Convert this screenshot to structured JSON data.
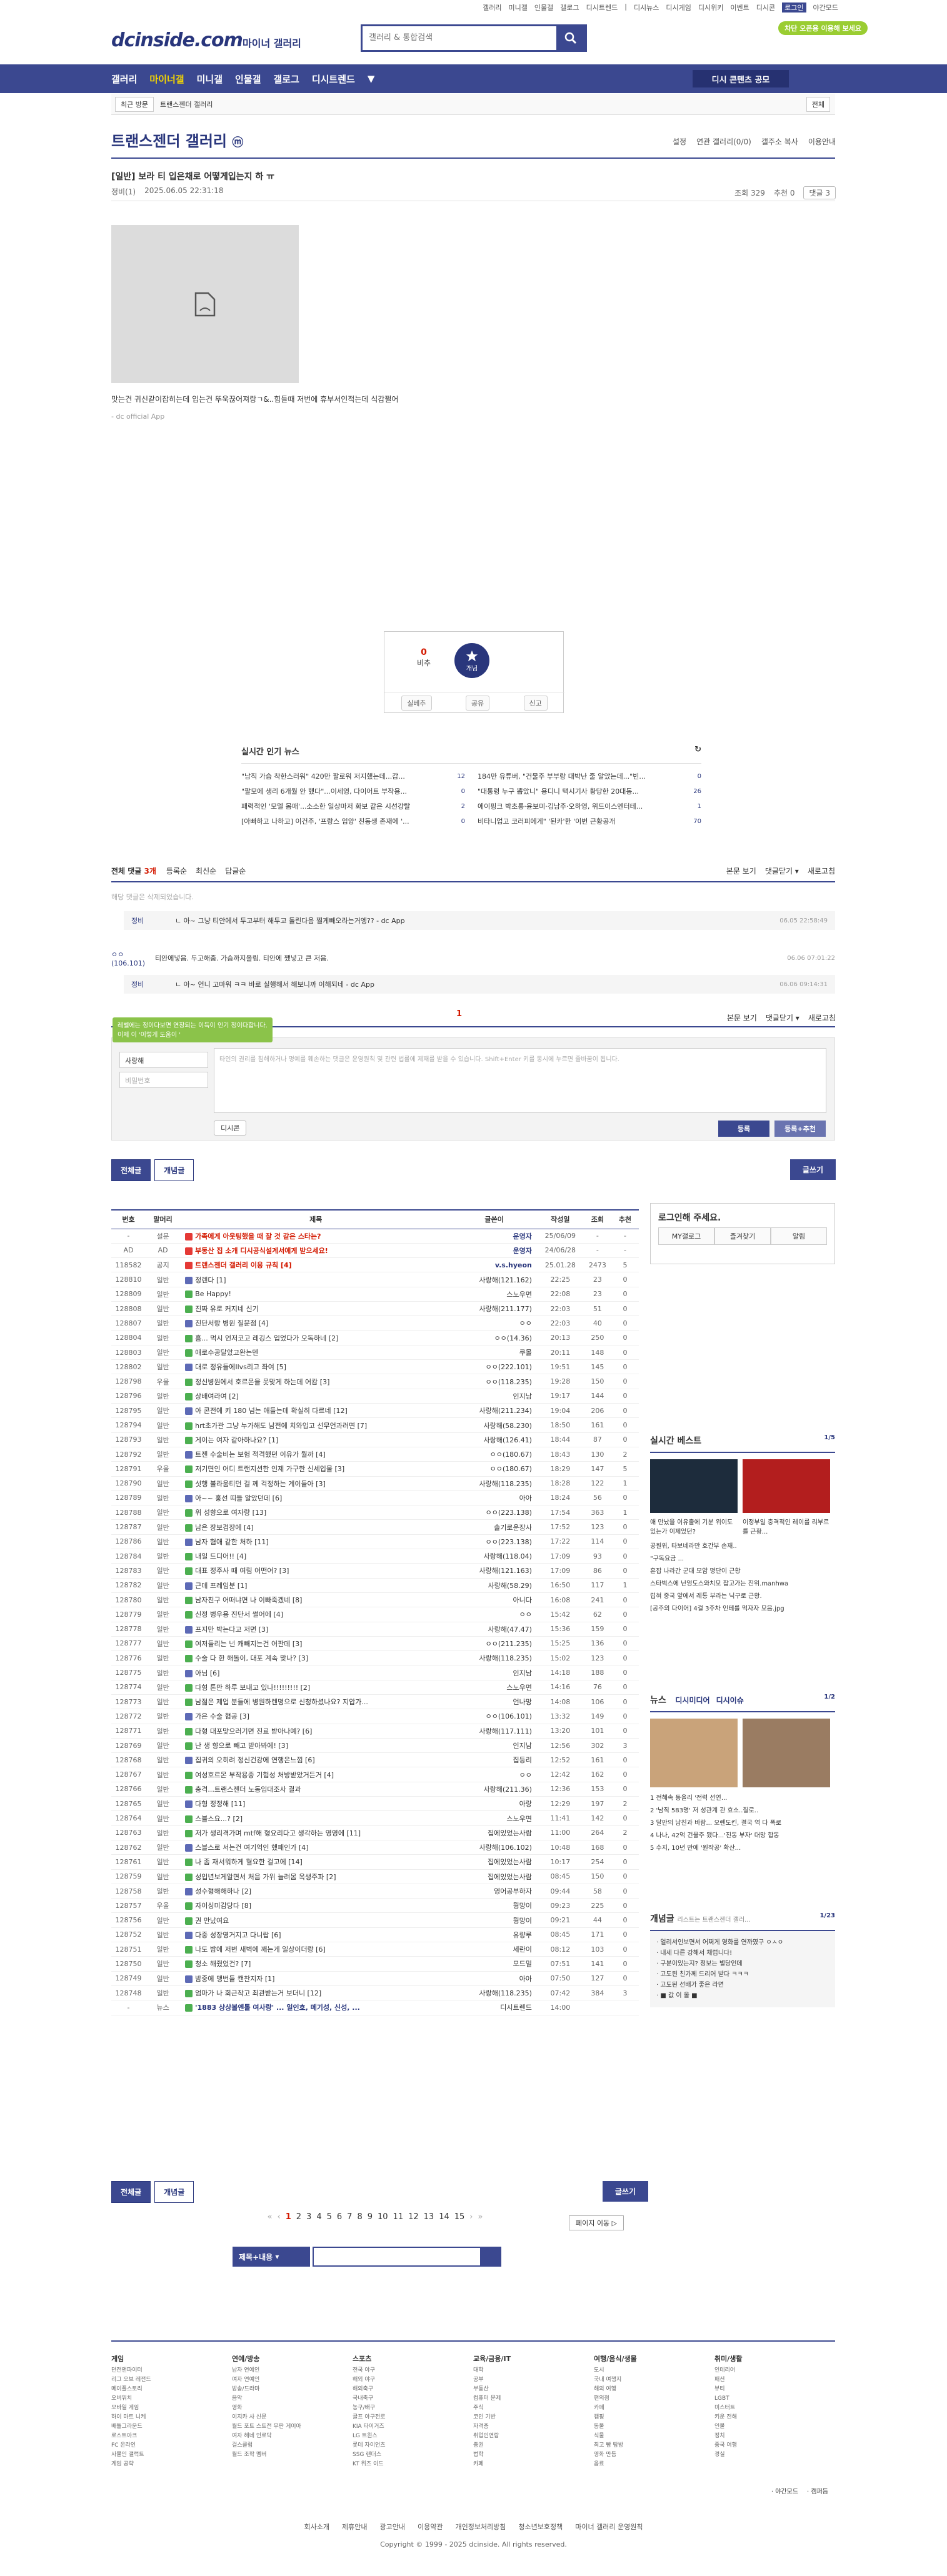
{
  "topnav": [
    "갤러리",
    "미니갤",
    "인물갤",
    "갤로그",
    "디시트렌드",
    "|",
    "디시뉴스",
    "디시게임",
    "디시위키",
    "이벤트",
    "디시콘",
    "로그인",
    "야간모드"
  ],
  "header": {
    "logo": "dcinside.com",
    "logo_sub": "마이너 갤러리",
    "search_placeholder": "갤러리 & 통합검색",
    "badge": "차단 오픈용 이용해 보세요"
  },
  "gnb": {
    "items": [
      "갤러리",
      "마이너갤",
      "미니갤",
      "인물갤",
      "갤로그",
      "디시트렌드",
      "▼"
    ],
    "active": 1,
    "button": "디시 콘텐츠 공모"
  },
  "subbar": {
    "left1": "최근 방문",
    "left2": "트랜스젠더 갤러리",
    "right": "전체"
  },
  "gallery": {
    "title": "트랜스젠더 갤러리",
    "badge": "ⓜ",
    "tools": [
      "설정",
      "연관 갤러리(0/0)",
      "갤주소 복사",
      "이용안내"
    ]
  },
  "post": {
    "title": "[일반] 보라 티 입은채로 어떻게입는지 하 ㅠ",
    "writer": "정비(1)",
    "date": "2025.06.05 22:31:18",
    "views": "조회 329",
    "recommend": "추천 0",
    "comments": "댓글 3",
    "body": "맛는건 귀신같이잡히는데 입는건 뚜욱끊어져랑ㄱ&..힘들때 저번에 휴부서인적는데 식감쩔어",
    "source": "- dc official App"
  },
  "rec": {
    "down": "0",
    "down_label": "비추",
    "up": "0",
    "up_label": "개념",
    "btns": [
      "실베추",
      "공유",
      "신고"
    ]
  },
  "news": {
    "title": "실시간 인기 뉴스",
    "left": [
      {
        "t": "\"남직 가습 착한스러워\" 420만 팔로워 저지했는데...갑...",
        "c": "12"
      },
      {
        "t": "\"팔모에 생리 6개월 안 했다\"...이세영, 다이어트 부작용...",
        "c": "0"
      },
      {
        "t": "패력적인 '모델 몸매'...소소한 일상마저 화보 같은 시선강탈",
        "c": "2"
      },
      {
        "t": "[아빠하고 나하고] 이건주, '프랑스 입양' 친동생 존재에 '...",
        "c": "0"
      }
    ],
    "right": [
      {
        "t": "184만 유튜버, \"건물주 부부랑 대박난 줄 알았는데...\"빈...",
        "c": "0"
      },
      {
        "t": "\"대통령 누구 뽑았니\" 용디니 택시기사 황당한 20대동...",
        "c": "26"
      },
      {
        "t": "에이핑크 박초롱·윤보미·김남주·오하영, 위드이스엔터테...",
        "c": "1"
      },
      {
        "t": "비타니업고 코러피에게\"  '된카'한 '이번 근황공개",
        "c": "70"
      }
    ]
  },
  "comments": {
    "count_label": "전체 댓글",
    "count": "3개",
    "sort": [
      "등록순",
      "최신순",
      "답글순"
    ],
    "tools": [
      "본문 보기",
      "댓글닫기 ▾",
      "새로고침"
    ],
    "deleted": "해당 댓글은 삭제되었습니다.",
    "items": [
      {
        "nick": "정비",
        "txt": "ㄴ 아~ 그냥 티안에서 두고부터 해두고 돌린다음 쩔게빼오라는거엥?? - dc App",
        "dt": "06.05 22:58:49",
        "reply": true
      },
      {
        "nick": "ㅇㅇ(106.101)",
        "txt": "티안에넣음. 두고해줌. 가슴까지올림. 티안에 쨌넣고 큰 저음.",
        "dt": "06.06 07:01:22",
        "reply": false
      },
      {
        "nick": "정비",
        "txt": "ㄴ 아~ 언니 고마워 ㅋㅋ 바로 실행해서 해보니까 이해되네 - dc App",
        "dt": "06.06 09:14:31",
        "reply": true
      }
    ],
    "page": "1",
    "tooltip": "레벨에는 정이다보면 연장되는 이득이 인기 정이다합니다. 이제 이 '이렇게 도움이 '",
    "nick_ph": "사랑해",
    "pw_ph": "비밀번호",
    "ta_ph": "타인의 권리를 침해하거나 명예를 훼손하는 댓글은 운영원칙 및 관련 법률에 제재를 받을 수 있습니다. Shift+Enter 키를 동시에 누르면 줄바꿈이 됩니다.",
    "dccon": "디시콘",
    "submit": "등록",
    "submit2": "등록+추천"
  },
  "list_btns": {
    "all": "전체글",
    "best": "개념글",
    "write": "글쓰기"
  },
  "board": {
    "headers": [
      "번호",
      "말머리",
      "제목",
      "글쓴이",
      "작성일",
      "조회",
      "추천"
    ],
    "rows": [
      {
        "n": "-",
        "h": "설문",
        "t": "가족에게 아웃팅했을 때 잘 것 같은 스타는?",
        "w": "운영자",
        "d": "25/06/09",
        "v": "-",
        "r": "-",
        "notice": true
      },
      {
        "n": "AD",
        "h": "AD",
        "t": "부동산 집 소개 디시공식설계서에게 받으세요!",
        "w": "운영자",
        "d": "24/06/28",
        "v": "-",
        "r": "-",
        "notice": true
      },
      {
        "n": "118582",
        "h": "공지",
        "t": "트랜스젠더 갤러리 이용 규칙 [4]",
        "w": "v.s.hyeon",
        "d": "25.01.28",
        "v": "2473",
        "r": "5",
        "notice": true
      },
      {
        "n": "128810",
        "h": "일반",
        "t": "정렌다 [1]",
        "w": "사랑해(121.162)",
        "d": "22:25",
        "v": "23",
        "r": "0"
      },
      {
        "n": "128809",
        "h": "일반",
        "t": "Be Happy!",
        "w": "스노우면",
        "d": "22:08",
        "v": "23",
        "r": "0"
      },
      {
        "n": "128808",
        "h": "일반",
        "t": "진짜 유로 커지네 신기",
        "w": "사랑해(211.177)",
        "d": "22:03",
        "v": "51",
        "r": "0"
      },
      {
        "n": "128807",
        "h": "일반",
        "t": "진단서랑 병원 질문점 [4]",
        "w": "ㅇㅇ",
        "d": "22:03",
        "v": "40",
        "r": "0"
      },
      {
        "n": "128804",
        "h": "일반",
        "t": "흠... 먹시 언저코고 레깅스 입었다가 오독하네 [2]",
        "w": "ㅇㅇ(14.36)",
        "d": "20:13",
        "v": "250",
        "r": "0"
      },
      {
        "n": "128803",
        "h": "일반",
        "t": "애로수공달았고완는덴",
        "w": "쿠몰",
        "d": "20:11",
        "v": "148",
        "r": "0"
      },
      {
        "n": "128802",
        "h": "일반",
        "t": "대로 정유들에Ilvs리고 좌여 [5]",
        "w": "ㅇㅇ(222.101)",
        "d": "19:51",
        "v": "145",
        "r": "0"
      },
      {
        "n": "128798",
        "h": "우울",
        "t": "정신병원에서 호르몬을 못맞게 하는데 어캄 [3]",
        "w": "ㅇㅇ(118.235)",
        "d": "19:28",
        "v": "150",
        "r": "0"
      },
      {
        "n": "128796",
        "h": "일반",
        "t": "상배여라여 [2]",
        "w": "인지남",
        "d": "19:17",
        "v": "144",
        "r": "0"
      },
      {
        "n": "128795",
        "h": "일반",
        "t": "아 콘전에 키 180 넘는 애들는데 확실히 다르네 [12]",
        "w": "사랑해(211.234)",
        "d": "19:04",
        "v": "206",
        "r": "0"
      },
      {
        "n": "128794",
        "h": "일반",
        "t": "hrt초가관 그냥 누가해도 남전에 치와입고 선무언과러면 [7]",
        "w": "사랑해(58.230)",
        "d": "18:50",
        "v": "161",
        "r": "0"
      },
      {
        "n": "128793",
        "h": "일반",
        "t": "게이는 여자 같아하나요? [1]",
        "w": "사랑해(126.41)",
        "d": "18:44",
        "v": "87",
        "r": "0"
      },
      {
        "n": "128792",
        "h": "일반",
        "t": "트젠 수술비는 보험 적격했던 이유가 뭘까 [4]",
        "w": "ㅇㅇ(180.67)",
        "d": "18:43",
        "v": "130",
        "r": "2"
      },
      {
        "n": "128791",
        "h": "우울",
        "t": "저기면인 어디 트랜지션한 인제 가구한 신세입물 [3]",
        "w": "ㅇㅇ(180.67)",
        "d": "18:29",
        "v": "147",
        "r": "5"
      },
      {
        "n": "128790",
        "h": "일반",
        "t": "섯행 불라움티던 걸 께 걱정하는 계이들아 [3]",
        "w": "사랑해(118.235)",
        "d": "18:28",
        "v": "122",
        "r": "1"
      },
      {
        "n": "128789",
        "h": "일반",
        "t": "아~~ 홍선 띠들 알았던데 [6]",
        "w": "아아",
        "d": "18:24",
        "v": "56",
        "r": "0"
      },
      {
        "n": "128788",
        "h": "일반",
        "t": "위 성향으로 여자랑 [13]",
        "w": "ㅇㅇ(223.138)",
        "d": "17:54",
        "v": "363",
        "r": "1"
      },
      {
        "n": "128787",
        "h": "일반",
        "t": "남은 장보검장에 [4]",
        "w": "솔기로운장사",
        "d": "17:52",
        "v": "123",
        "r": "0"
      },
      {
        "n": "128786",
        "h": "일반",
        "t": "남자 혐애 같한 처하 [11]",
        "w": "ㅇㅇ(223.138)",
        "d": "17:22",
        "v": "114",
        "r": "0"
      },
      {
        "n": "128784",
        "h": "일반",
        "t": "내일 드디어!! [4]",
        "w": "사랑해(118.04)",
        "d": "17:09",
        "v": "93",
        "r": "0"
      },
      {
        "n": "128783",
        "h": "일반",
        "t": "대표 정주사 때 여림 어떤어? [3]",
        "w": "사랑해(121.163)",
        "d": "17:09",
        "v": "86",
        "r": "0"
      },
      {
        "n": "128782",
        "h": "일반",
        "t": "근데 프레임분 [1]",
        "w": "사랑해(58.29)",
        "d": "16:50",
        "v": "117",
        "r": "1"
      },
      {
        "n": "128780",
        "h": "일반",
        "t": "남자친구 어떠냐면 나 이빠죽겠네 [8]",
        "w": "아니다",
        "d": "16:08",
        "v": "241",
        "r": "0"
      },
      {
        "n": "128779",
        "h": "일반",
        "t": "신정 병우용 진단서 썰어에 [4]",
        "w": "ㅇㅇ",
        "d": "15:42",
        "v": "62",
        "r": "0"
      },
      {
        "n": "128778",
        "h": "일반",
        "t": "프지만 박는다고 저면 [3]",
        "w": "사랑해(47.47)",
        "d": "15:36",
        "v": "159",
        "r": "0"
      },
      {
        "n": "128777",
        "h": "일반",
        "t": "여저들리는 넌 캐빼지는건 어판데 [3]",
        "w": "ㅇㅇ(211.235)",
        "d": "15:25",
        "v": "136",
        "r": "0"
      },
      {
        "n": "128776",
        "h": "일반",
        "t": "수술 다 한 해돌이, 대포 계속 맞나? [3]",
        "w": "사랑해(118.235)",
        "d": "15:02",
        "v": "123",
        "r": "0"
      },
      {
        "n": "128775",
        "h": "일반",
        "t": "아님 [6]",
        "w": "인지남",
        "d": "14:18",
        "v": "188",
        "r": "0"
      },
      {
        "n": "128774",
        "h": "일반",
        "t": "다형 톤만 하루 보내고 있나!!!!!!!!! [2]",
        "w": "스노우면",
        "d": "14:16",
        "v": "76",
        "r": "0"
      },
      {
        "n": "128773",
        "h": "일반",
        "t": "남젊은 제업 분들에 병원하렌명으로 신청하셨나요? 지압가...",
        "w": "언나망",
        "d": "14:08",
        "v": "106",
        "r": "0"
      },
      {
        "n": "128772",
        "h": "일반",
        "t": "가은 수술 협공 [3]",
        "w": "ㅇㅇ(106.101)",
        "d": "13:32",
        "v": "149",
        "r": "0"
      },
      {
        "n": "128771",
        "h": "일반",
        "t": "다형 대포맞으러기면 진료 받아나예? [6]",
        "w": "사랑해(117.111)",
        "d": "13:20",
        "v": "101",
        "r": "0"
      },
      {
        "n": "128769",
        "h": "일반",
        "t": "난 생 향으로 빼고 받아봐에! [3]",
        "w": "인지남",
        "d": "12:56",
        "v": "302",
        "r": "3"
      },
      {
        "n": "128768",
        "h": "일반",
        "t": "집귀의 오히려 정신건강에 연행은느낌 [6]",
        "w": "집등리",
        "d": "12:52",
        "v": "161",
        "r": "0"
      },
      {
        "n": "128767",
        "h": "일반",
        "t": "여성호르몬 부작용중 기험성 처방받았거든거 [4]",
        "w": "ㅇㅇ",
        "d": "12:42",
        "v": "162",
        "r": "0"
      },
      {
        "n": "128766",
        "h": "일반",
        "t": "충격...트랜스젠더 노동임대조사 결과",
        "w": "사랑해(211.36)",
        "d": "12:36",
        "v": "153",
        "r": "0"
      },
      {
        "n": "128765",
        "h": "일반",
        "t": "다형 정정해 [11]",
        "w": "아랑",
        "d": "12:29",
        "v": "197",
        "r": "2"
      },
      {
        "n": "128764",
        "h": "일반",
        "t": "스블스요...? [2]",
        "w": "스노우면",
        "d": "11:41",
        "v": "142",
        "r": "0"
      },
      {
        "n": "128763",
        "h": "일반",
        "t": "저가 생리격가며 mtf해 형요리다고 생각하는 영영에 [11]",
        "w": "집에있었는사람",
        "d": "11:00",
        "v": "264",
        "r": "2"
      },
      {
        "n": "128762",
        "h": "일반",
        "t": "스블스로 서는건 여기억인 했패인가 [4]",
        "w": "사랑해(106.102)",
        "d": "10:48",
        "v": "168",
        "r": "0"
      },
      {
        "n": "128761",
        "h": "일반",
        "t": "나 좀 재서워하게 혈요한 걸고에 [14]",
        "w": "집에있었는사람",
        "d": "10:17",
        "v": "254",
        "r": "0"
      },
      {
        "n": "128759",
        "h": "일반",
        "t": "성입년보게알면서 처음 가위 늘려몸 옥생주파 [2]",
        "w": "집에있었는사람",
        "d": "08:45",
        "v": "150",
        "r": "0"
      },
      {
        "n": "128758",
        "h": "일반",
        "t": "성수형해해하나 [2]",
        "w": "영어공부하자",
        "d": "09:44",
        "v": "58",
        "r": "0"
      },
      {
        "n": "128757",
        "h": "우울",
        "t": "자이싱미감당다 [8]",
        "w": "뭥망이",
        "d": "09:23",
        "v": "225",
        "r": "0"
      },
      {
        "n": "128756",
        "h": "일반",
        "t": "권 만났여요",
        "w": "뭥망이",
        "d": "09:21",
        "v": "44",
        "r": "0"
      },
      {
        "n": "128752",
        "h": "일반",
        "t": "다중 성장영거지고 다니랍 [6]",
        "w": "유량루",
        "d": "08:45",
        "v": "171",
        "r": "0"
      },
      {
        "n": "128751",
        "h": "일반",
        "t": "나도 밤에 저번 새벽에 깨는게 일상이더랑 [6]",
        "w": "세란이",
        "d": "08:12",
        "v": "103",
        "r": "0"
      },
      {
        "n": "128750",
        "h": "일반",
        "t": "청소 해줬었건? [7]",
        "w": "모드밀",
        "d": "07:51",
        "v": "141",
        "r": "0"
      },
      {
        "n": "128749",
        "h": "일반",
        "t": "밤중에 맹번들 캔찬지자 [1]",
        "w": "아아",
        "d": "07:50",
        "v": "127",
        "r": "0"
      },
      {
        "n": "128748",
        "h": "일반",
        "t": "엄마가 나 회근작고 최관받는거 보더니 [12]",
        "w": "사랑해(118.235)",
        "d": "07:42",
        "v": "384",
        "r": "3"
      },
      {
        "n": "-",
        "h": "뉴스",
        "t": "'1883 상상볼엔톨 여사랑' ... 일인호, 메기성, 신성, ...",
        "w": "디시트렌드",
        "d": "14:00",
        "v": "",
        "r": "",
        "news": true
      }
    ]
  },
  "pager": {
    "first": "«",
    "prev": "‹",
    "pages": [
      "1",
      "2",
      "3",
      "4",
      "5",
      "6",
      "7",
      "8",
      "9",
      "10",
      "11",
      "12",
      "13",
      "14",
      "15"
    ],
    "next": "›",
    "last": "»",
    "move": "페이지 이동 ▷"
  },
  "search2": {
    "select": "제목+내용"
  },
  "side": {
    "login_title": "로그인해 주세요.",
    "login_links": [
      "MY갤로그",
      "즐겨찾기",
      "알림"
    ],
    "live_title": "실시간 베스트",
    "live_page": "1/5",
    "live_caps": [
      "애 만났을 이유출에 기분 위이도 있는가 이제었던?",
      "이정부일 충격적인 레이를 리부르를 근황..."
    ],
    "live_list": [
      "공원위, 타보네라만 호간부 손재..",
      "\"구독요금 ...",
      "혼잡 나라간 군대 모암 명단이 근황",
      "스타벅스에 난엉도스와치모 잡고가는 진위.manhwa",
      "럽혀 중국 앞에서 레통 부라는 닉구로 근황.",
      "[공주의 다이어] 4걸 3주차 인테를 먹자자 모음.jpg"
    ],
    "news_title": "뉴스",
    "news_tabs": [
      "디시미디어",
      "디시이슈"
    ],
    "news_page": "1/2",
    "news_list": [
      "1 전혜속 동을리 '전력 선연...",
      "2 '남직 583명' 저 성관계 관 효소..질로..",
      "3 달만의 남친과 바람... 오렌도킨, 결국 역 다 폭로",
      "4 나나, 42억 건물주 됐다...'진동 부자' 대망 합동",
      "5 수지, 10년 만에 '원작공' 확산..."
    ],
    "kw_title": "개념글",
    "kw_sub": "리스트는 트랜스젠더 갤러...",
    "kw_page": "1/23",
    "kw_list": [
      "· 얼리서인보면서 어쩌게 영화를 연까였구 ㅇㅅㅇ",
      "· 내세 다른 강해서 채럽니다!",
      "· 구분이있는지? 정보는 별당인데",
      "· 고도된 친가께 드리어 받다 ㅋㅋㅋ",
      "· 고도된 선배가 좋은 라면",
      "· ■ 값 이 올 ■"
    ]
  },
  "footer": {
    "cols": [
      {
        "h": "게임",
        "items": [
          "던전앤파이터",
          "리그 오브 레전드",
          "메이플스토리",
          "오버워치",
          "모바일 게임",
          "하이 마트 니케",
          "배틀그라운드",
          "로스트아크",
          "FC 온라인",
          "사물인 갤럭트",
          "게임 공략"
        ]
      },
      {
        "h": "연예/방송",
        "items": [
          "남자 연예인",
          "여자 연예인",
          "방송/드라마",
          "음악",
          "영화",
          "이지카 사 신문",
          "월드 포트 스트전 무판 게이아",
          "여자 헤네 인로닥",
          "걸스클럽",
          "월드 조학 멤버"
        ]
      },
      {
        "h": "스포츠",
        "items": [
          "전국 야구",
          "해외 야구",
          "해외축구",
          "국내축구",
          "농구/배구",
          "골프 야구전로",
          "KIA 타이거즈",
          "LG 트윈스",
          "롯데 자이언츠",
          "SSG 랜더스",
          "KT 위즈 이드"
        ]
      },
      {
        "h": "교육/금융/IT",
        "items": [
          "대학",
          "공부",
          "부동산",
          "컴퓨터 문제",
          "주식",
          "코인 기반",
          "자격증",
          "취업인연람",
          "증권",
          "법학",
          "카페"
        ]
      },
      {
        "h": "여행/음식/생물",
        "items": [
          "도시",
          "국내 여행지",
          "해외 여행",
          "편의점",
          "카페",
          "캠핑",
          "동물",
          "식물",
          "최고 빵 탐방",
          "영화 만듬",
          "음료"
        ]
      },
      {
        "h": "취미/생활",
        "items": [
          "인테리어",
          "패션",
          "뷰티",
          "LGBT",
          "미스터트",
          "키운 전해",
          "인물",
          "정치",
          "중국 여행",
          "경실"
        ]
      }
    ],
    "aux": [
      "· 야간모드",
      "· 캠퍼듬"
    ],
    "links": [
      "회사소개",
      "제휴안내",
      "광고안내",
      "이용약관",
      "개인정보처리방침",
      "청소년보호정책",
      "마이너 갤러리 운영원칙"
    ],
    "copyright": "Copyright © 1999 - 2025 dcinside. All rights reserved."
  },
  "colors": {
    "primary": "#3b4890",
    "dark": "#29367c",
    "red": "#d31900",
    "green": "#9acd32"
  }
}
